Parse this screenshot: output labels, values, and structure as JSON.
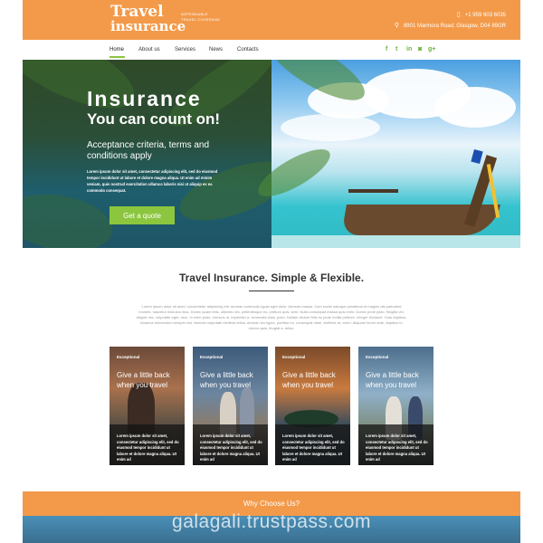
{
  "brand": {
    "line1": "Travel",
    "line2": "insurance",
    "tagline_1": "DEPENDABLE",
    "tagline_2": "TRAVEL COVERAGE"
  },
  "contact": {
    "phone": "+1 959 603 6035",
    "address": "8901 Marmora Road, Glasgow, D04 89GR"
  },
  "nav": {
    "items": [
      "Home",
      "About us",
      "Services",
      "News",
      "Contacts"
    ],
    "active": "Home"
  },
  "social_icons": [
    "facebook-icon",
    "twitter-icon",
    "linkedin-icon",
    "instagram-icon",
    "google-plus-icon"
  ],
  "hero": {
    "title": "Insurance",
    "subtitle": "You can count on!",
    "heading": "Acceptance criteria, terms and conditions apply",
    "body": "Lorem ipsum dolor sit amet, consectetur adipiscing elit, sed do eiusmod tempor incididunt ut labore et dolore magna aliqua. Ut enim ad minim veniam, quis nostrud exercitation ullamco laboris nisi ut aliquip ex ea commodo consequat.",
    "button": "Get a quote"
  },
  "section": {
    "title": "Travel Insurance. Simple & Flexible.",
    "body": "Lorem ipsum dolor sit amet, consectetur adipiscing elit. Aenean commodo ligula eget dolor. Aenean massa. Cum sociis natoque penatibus et magnis dis parturient montes, nascetur ridiculus mus. Donec quam felis, ultricies nec, pellentesque eu, pretium quis, sem. Nulla consequat massa quis enim. Donec pede justo, fringilla vel, aliquet nec, vulputate eget, arcu. In enim justo, rhoncus ut, imperdiet a, venenatis vitae, justo. Nullam dictum felis eu pede mollis pretium. Integer tincidunt. Cras dapibus. Vivamus elementum semper nisi. Aenean vulputate eleifend tellus. Aenean leo ligula, porttitor eu, consequat vitae, eleifend ac, enim. Aliquam lorem ante, dapibus in, viverra quis, feugiat a, tellus."
  },
  "cards": [
    {
      "label": "Exceptional",
      "title": "Give a little back when you travel",
      "text": "Lorem ipsum dolor sit amet, consectetur adipiscing elit, sed do eiusmod tempor incididunt ut labore et dolore magna aliqua. Ut enim ad"
    },
    {
      "label": "Exceptional",
      "title": "Give a little back when you travel",
      "text": "Lorem ipsum dolor sit amet, consectetur adipiscing elit, sed do eiusmod tempor incididunt ut labore et dolore magna aliqua. Ut enim ad"
    },
    {
      "label": "Exceptional",
      "title": "Give a little back when you travel",
      "text": "Lorem ipsum dolor sit amet, consectetur adipiscing elit, sed do eiusmod tempor incididunt ut labore et dolore magna aliqua. Ut enim ad"
    },
    {
      "label": "Exceptional",
      "title": "Give a little back when you travel",
      "text": "Lorem ipsum dolor sit amet, consectetur adipiscing elit, sed do eiusmod tempor incididunt ut labore et dolore magna aliqua. Ut enim ad"
    }
  ],
  "why": {
    "title": "Why Choose Us?"
  },
  "watermark": "galagali.trustpass.com",
  "colors": {
    "accent_orange": "#f39a4a",
    "accent_green": "#8cc63f"
  }
}
